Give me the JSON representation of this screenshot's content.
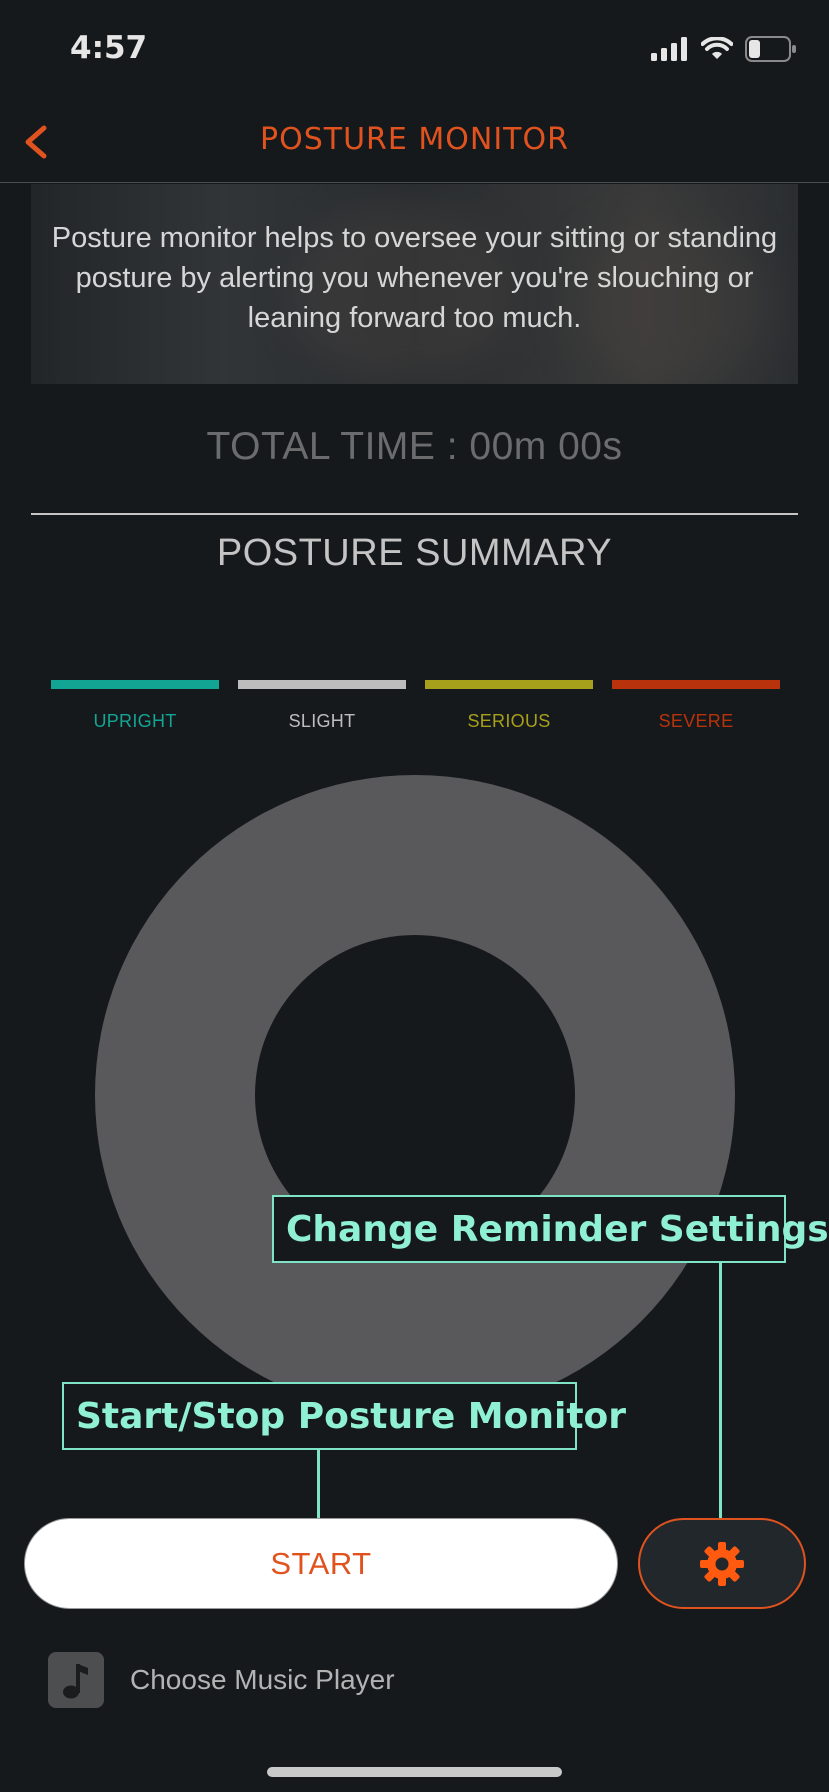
{
  "status_bar": {
    "time": "4:57",
    "icons": [
      "signal-icon",
      "wifi-icon",
      "battery-icon"
    ]
  },
  "nav": {
    "title": "POSTURE MONITOR",
    "back_icon": "chevron-left-icon"
  },
  "banner": {
    "text": "Posture monitor helps to oversee your sitting or standing posture by alerting you whenever you're slouching or leaning forward too much."
  },
  "total_time": "TOTAL TIME : 00m 00s",
  "summary": {
    "title": "POSTURE SUMMARY",
    "legend": [
      {
        "label": "UPRIGHT",
        "color": "#13a594"
      },
      {
        "label": "SLIGHT",
        "color": "#bdbdbd"
      },
      {
        "label": "SERIOUS",
        "color": "#a7a01a"
      },
      {
        "label": "SEVERE",
        "color": "#b8330b"
      }
    ],
    "donut_color": "#59595b"
  },
  "callouts": {
    "settings": "Change Reminder Settings",
    "start_stop": "Start/Stop Posture Monitor"
  },
  "controls": {
    "start_label": "START",
    "settings_icon": "gear-icon"
  },
  "music": {
    "label": "Choose Music Player",
    "icon": "music-note-icon"
  },
  "colors": {
    "accent": "#e0531f",
    "callout": "#7fe4c5",
    "background": "#16191c"
  }
}
